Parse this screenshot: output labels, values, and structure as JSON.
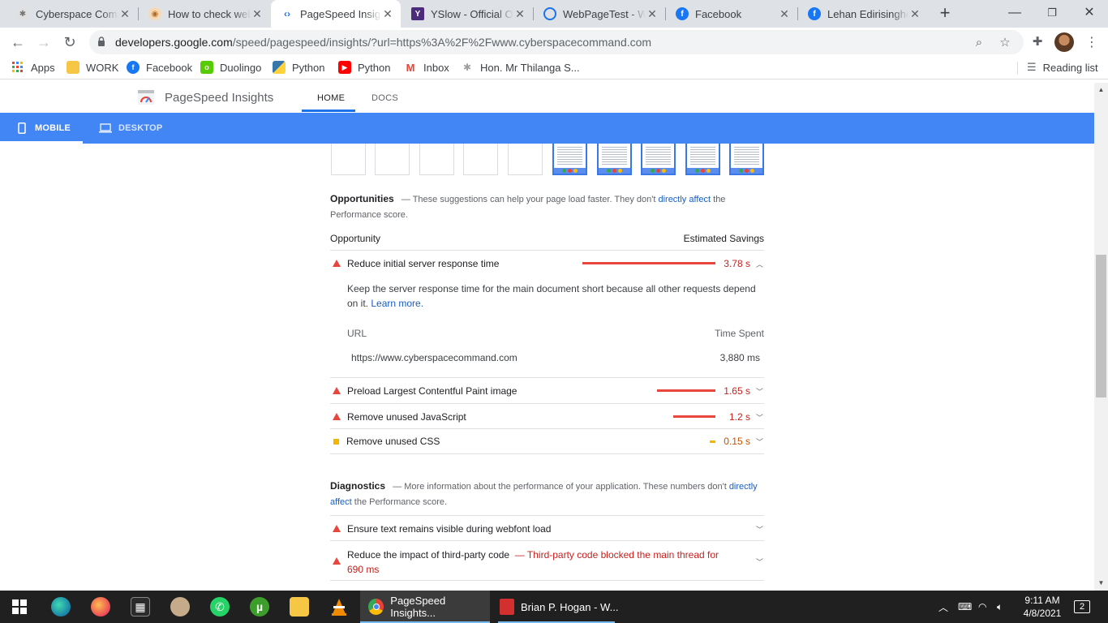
{
  "browser": {
    "tabs": [
      {
        "title": "Cyberspace Comm",
        "icon": "cyberspace-favicon",
        "color": "#9e9e9e"
      },
      {
        "title": "How to check web",
        "icon": "howto-favicon",
        "color": "#b06d2e"
      },
      {
        "title": "PageSpeed Insigh",
        "icon": "pagespeed-favicon",
        "color": "#1a73e8",
        "active": true
      },
      {
        "title": "YSlow - Official Op",
        "icon": "yslow-favicon",
        "color": "#4a2c7a"
      },
      {
        "title": "WebPageTest - We",
        "icon": "webpagetest-favicon",
        "color": "#1a73e8"
      },
      {
        "title": "Facebook",
        "icon": "facebook-favicon",
        "color": "#1877f2"
      },
      {
        "title": "Lehan Edirisinghe",
        "icon": "facebook-favicon",
        "color": "#1877f2"
      }
    ],
    "url_host": "developers.google.com",
    "url_path": "/speed/pagespeed/insights/?url=https%3A%2F%2Fwww.cyberspacecommand.com",
    "bookmarks": [
      {
        "label": "Apps",
        "icon": "apps-grid-icon",
        "color": "#ea4335"
      },
      {
        "label": "WORK",
        "icon": "folder-icon",
        "color": "#f6c744"
      },
      {
        "label": "Facebook",
        "icon": "facebook-icon",
        "color": "#1877f2"
      },
      {
        "label": "Duolingo",
        "icon": "duolingo-icon",
        "color": "#58cc02"
      },
      {
        "label": "Python",
        "icon": "python-icon",
        "color": "#3776ab"
      },
      {
        "label": "Python",
        "icon": "youtube-icon",
        "color": "#ff0000"
      },
      {
        "label": "Inbox",
        "icon": "gmail-icon",
        "color": "#ea4335"
      },
      {
        "label": "Hon. Mr Thilanga S...",
        "icon": "seal-icon",
        "color": "#9e9e9e"
      }
    ],
    "reading_list": "Reading list"
  },
  "psi": {
    "title": "PageSpeed Insights",
    "nav": {
      "home": "HOME",
      "docs": "DOCS"
    },
    "devices": {
      "mobile": "MOBILE",
      "desktop": "DESKTOP"
    },
    "filmstrip_frames": 10,
    "filmstrip_loaded_from": 5
  },
  "opportunities": {
    "heading": "Opportunities",
    "desc_prefix": "— These suggestions can help your page load faster. They don't ",
    "desc_link": "directly affect",
    "desc_suffix": " the Performance score.",
    "col_left": "Opportunity",
    "col_right": "Estimated Savings",
    "items": [
      {
        "title": "Reduce initial server response time",
        "savings": "3.78 s",
        "savings_s": 3.78,
        "severity": "fail",
        "expanded": true
      },
      {
        "title": "Preload Largest Contentful Paint image",
        "savings": "1.65 s",
        "savings_s": 1.65,
        "severity": "fail"
      },
      {
        "title": "Remove unused JavaScript",
        "savings": "1.2 s",
        "savings_s": 1.2,
        "severity": "fail"
      },
      {
        "title": "Remove unused CSS",
        "savings": "0.15 s",
        "savings_s": 0.15,
        "severity": "average"
      }
    ],
    "expanded_detail": {
      "text": "Keep the server response time for the main document short because all other requests depend on it.",
      "learn_more": "Learn more.",
      "col_url": "URL",
      "col_time": "Time Spent",
      "rows": [
        {
          "url": "https://www.cyberspacecommand.com",
          "time": "3,880 ms"
        }
      ]
    }
  },
  "diagnostics": {
    "heading": "Diagnostics",
    "desc_prefix": "— More information about the performance of your application. These numbers don't ",
    "desc_link": "directly affect",
    "desc_suffix": " the Performance score.",
    "items": [
      {
        "title": "Ensure text remains visible during webfont load"
      },
      {
        "title": "Reduce the impact of third-party code",
        "note": "— Third-party code blocked the main thread for 690 ms"
      }
    ]
  },
  "taskbar": {
    "apps": [
      {
        "label": "PageSpeed Insights...",
        "icon": "chrome-icon"
      },
      {
        "label": "Brian P. Hogan - W...",
        "icon": "pdf-icon"
      }
    ],
    "time": "9:11 AM",
    "date": "4/8/2021",
    "notifications": "2"
  },
  "colors": {
    "accent": "#4285f4",
    "fail": "#e8453c",
    "average": "#f4b400",
    "link": "#1a5ec0"
  }
}
